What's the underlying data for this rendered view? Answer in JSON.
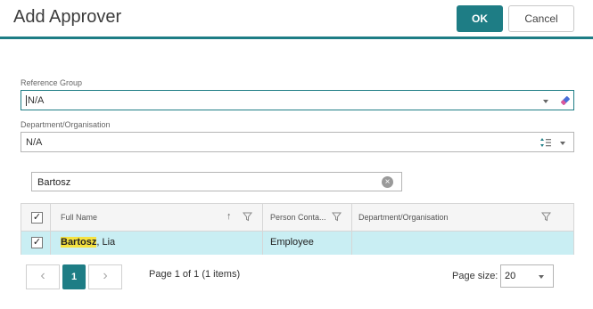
{
  "dialog": {
    "title": "Add Approver",
    "ok_label": "OK",
    "cancel_label": "Cancel"
  },
  "reference_group": {
    "label": "Reference Group",
    "value": "N/A"
  },
  "department": {
    "label": "Department/Organisation",
    "value": "N/A"
  },
  "search": {
    "value": "Bartosz"
  },
  "grid": {
    "columns": [
      "Full Name",
      "Person Conta...",
      "Department/Organisation"
    ],
    "rows": [
      {
        "name_highlight": "Bartosz",
        "name_rest": ", Lia",
        "contact_type": "Employee",
        "department": ""
      }
    ]
  },
  "pager": {
    "current_page": "1",
    "info": "Page 1 of 1 (1 items)",
    "page_size_label": "Page size:",
    "page_size": "20"
  },
  "colors": {
    "accent": "#1e7d85",
    "row_selected": "#c9eef3",
    "highlight": "#f5e240"
  }
}
